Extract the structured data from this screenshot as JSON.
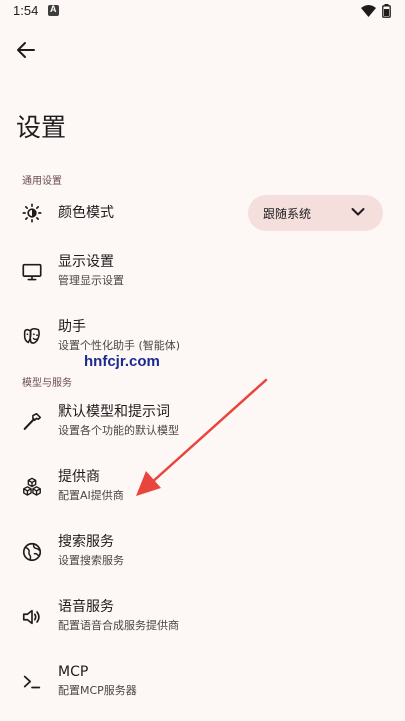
{
  "status_bar": {
    "time": "1:54",
    "icons": [
      "notification-a-icon",
      "wifi-icon",
      "battery-icon"
    ]
  },
  "app_bar": {
    "back_icon": "back-arrow-icon"
  },
  "page": {
    "title": "设置"
  },
  "sections": {
    "general": {
      "header": "通用设置",
      "color_mode": {
        "icon": "brightness-icon",
        "title": "颜色模式",
        "dropdown_value": "跟随系统",
        "dropdown_icon": "chevron-down-icon"
      },
      "display": {
        "icon": "monitor-icon",
        "title": "显示设置",
        "subtitle": "管理显示设置"
      },
      "assistant": {
        "icon": "mask-icon",
        "title": "助手",
        "subtitle": "设置个性化助手 (智能体)"
      }
    },
    "models": {
      "header": "模型与服务",
      "default_model": {
        "icon": "hammer-icon",
        "title": "默认模型和提示词",
        "subtitle": "设置各个功能的默认模型"
      },
      "provider": {
        "icon": "cubes-icon",
        "title": "提供商",
        "subtitle": "配置AI提供商"
      },
      "search": {
        "icon": "globe-icon",
        "title": "搜索服务",
        "subtitle": "设置搜索服务"
      },
      "voice": {
        "icon": "speaker-icon",
        "title": "语音服务",
        "subtitle": "配置语音合成服务提供商"
      },
      "mcp": {
        "icon": "terminal-icon",
        "title": "MCP",
        "subtitle": "配置MCP服务器"
      }
    }
  },
  "watermark": {
    "text": "hnfcjr.com"
  },
  "colors": {
    "background": "#fdf7f6",
    "dropdown_bg": "#f4dfdd",
    "text": "#1d1b1b",
    "section_header": "#6d4d4d",
    "annotation_arrow": "#e8453c",
    "watermark": "#1a2b8f"
  }
}
